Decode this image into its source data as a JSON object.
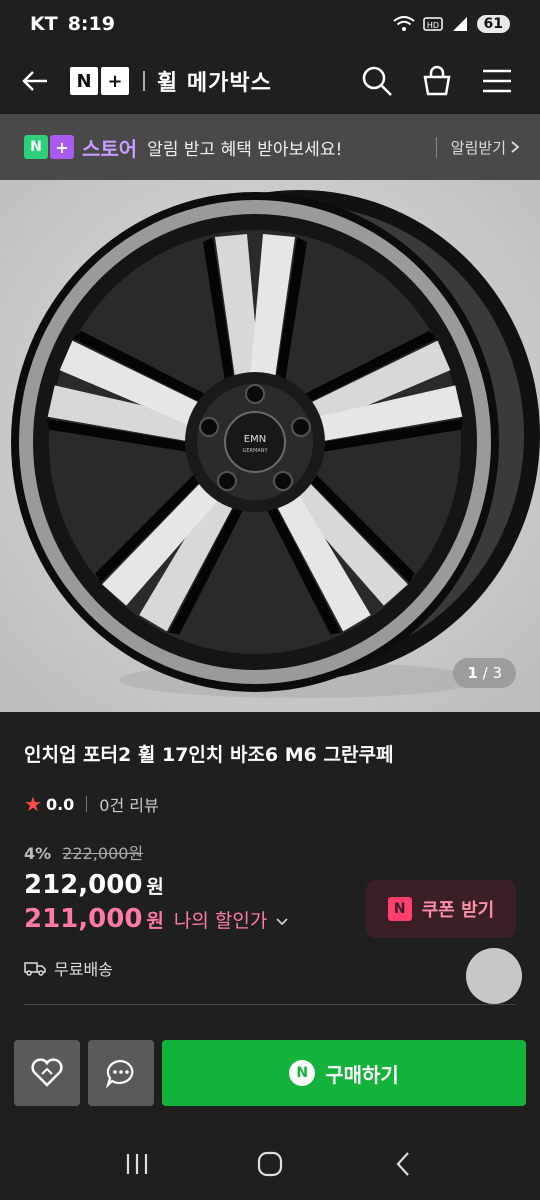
{
  "status_bar": {
    "carrier": "KT",
    "time": "8:19",
    "battery": "61"
  },
  "header": {
    "logo_text": "N+",
    "shop_name": "휠 메가박스"
  },
  "store_banner": {
    "logo_word": "스토어",
    "message": "알림 받고 혜택 받아보세요!",
    "cta": "알림받기"
  },
  "image": {
    "current": "1",
    "total": "/ 3"
  },
  "product": {
    "title": "인치업 포터2 휠 17인치 바조6 M6 그란쿠페",
    "rating": "0.0",
    "review_count": "0건 리뷰",
    "discount_pct": "4%",
    "original_price": "222,000원",
    "price": "212,000",
    "price_unit": "원",
    "my_price": "211,000",
    "my_price_unit": "원",
    "my_price_label": "나의 할인가",
    "coupon_label": "쿠폰 받기",
    "shipping": "무료배송"
  },
  "actions": {
    "buy_label": "구매하기"
  },
  "colors": {
    "buy_green": "#13b33b",
    "discount_pink": "#ff7aa5",
    "store_purple": "#c89bff"
  }
}
